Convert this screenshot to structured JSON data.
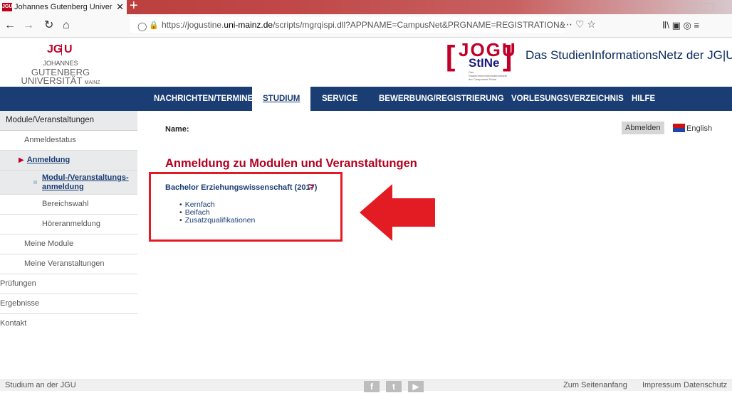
{
  "browser": {
    "tab_title": "Johannes Gutenberg Universitä",
    "tab_close": "✕",
    "new_tab": "+",
    "url_prefix": "https://jogustine.",
    "url_domain": "uni-mainz.de",
    "url_rest": "/scripts/mgrqispi.dll?APPNAME=CampusNet&PRGNAME=REGISTRATION&ARGUMEI",
    "url_actions": "⋯  ♡  ☆",
    "right_icons": "Ⅱ\\  ▣  ◎  ≡"
  },
  "header": {
    "logo_jg": "JG",
    "logo_u": "U",
    "uni_line1_small": "JOHANNES",
    "uni_line1_big": "GUTENBERG",
    "uni_line2": "UNIVERSITÄT",
    "uni_line2_small": "MAINZ",
    "jogu_text": "JOGU",
    "stine_text": "StINe",
    "jogu_small": "Das StudierendenInformationsNetz der Campusnet Portal",
    "tagline": "Das StudienInformationsNetz der JG|U"
  },
  "nav": {
    "items": [
      {
        "label": "NACHRICHTEN/TERMINE"
      },
      {
        "label": "STUDIUM"
      },
      {
        "label": "SERVICE"
      },
      {
        "label": "BEWERBUNG/REGISTRIERUNG"
      },
      {
        "label": "VORLESUNGSVERZEICHNIS"
      },
      {
        "label": "HILFE"
      }
    ],
    "active": "STUDIUM"
  },
  "sidebar": {
    "items": [
      {
        "label": "Module/Veranstaltungen"
      },
      {
        "label": "Anmeldestatus"
      },
      {
        "label": "Anmeldung"
      },
      {
        "label": "Modul-/Veranstaltungs-"
      },
      {
        "label": "anmeldung"
      },
      {
        "label": "Bereichswahl"
      },
      {
        "label": "Höreranmeldung"
      },
      {
        "label": "Meine Module"
      },
      {
        "label": "Meine Veranstaltungen"
      },
      {
        "label": "Prüfungen"
      },
      {
        "label": "Ergebnisse"
      },
      {
        "label": "Kontakt"
      }
    ]
  },
  "content": {
    "name_label": "Name:",
    "logout": "Abmelden",
    "language": "English",
    "heading": "Anmeldung zu Modulen und Veranstaltungen",
    "degree": "Bachelor Erziehungswissenschaft (2017)",
    "degree_arrow": ">",
    "subitems": [
      "Kernfach",
      "Beifach",
      "Zusatzqualifikationen"
    ]
  },
  "footer": {
    "left": "Studium an der JGU",
    "social": [
      "f",
      "t",
      "▶"
    ],
    "links": [
      "Zum Seitenanfang",
      "Impressum",
      "Datenschutz"
    ]
  },
  "colors": {
    "nav_bg": "#1a3d73",
    "jgu_red": "#c1002a",
    "highlight_box": "#e31b23"
  }
}
